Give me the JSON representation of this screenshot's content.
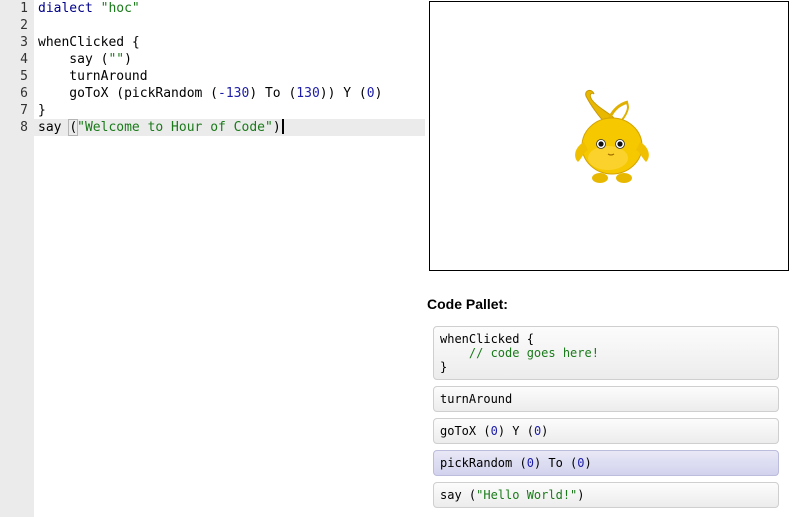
{
  "editor": {
    "lines": [
      {
        "num": "1",
        "parts": [
          {
            "t": "dialect ",
            "c": "kw"
          },
          {
            "t": "\"hoc\"",
            "c": "str"
          }
        ]
      },
      {
        "num": "2",
        "parts": []
      },
      {
        "num": "3",
        "parts": [
          {
            "t": "whenClicked {",
            "c": ""
          }
        ]
      },
      {
        "num": "4",
        "parts": [
          {
            "t": "    say (",
            "c": ""
          },
          {
            "t": "\"\"",
            "c": "str"
          },
          {
            "t": ")",
            "c": ""
          }
        ]
      },
      {
        "num": "5",
        "parts": [
          {
            "t": "    turnAround",
            "c": ""
          }
        ]
      },
      {
        "num": "6",
        "parts": [
          {
            "t": "    goToX (pickRandom (",
            "c": ""
          },
          {
            "t": "-130",
            "c": "num"
          },
          {
            "t": ") To (",
            "c": ""
          },
          {
            "t": "130",
            "c": "num"
          },
          {
            "t": ")) Y (",
            "c": ""
          },
          {
            "t": "0",
            "c": "num"
          },
          {
            "t": ")",
            "c": ""
          }
        ]
      },
      {
        "num": "7",
        "parts": [
          {
            "t": "}",
            "c": ""
          }
        ]
      },
      {
        "num": "8",
        "parts": [
          {
            "t": "say ",
            "c": ""
          },
          {
            "t": "(",
            "c": "paren"
          },
          {
            "t": "\"Welcome to Hour of Code\"",
            "c": "str"
          },
          {
            "t": ")",
            "c": ""
          }
        ],
        "active": true
      }
    ]
  },
  "stage": {
    "sprite": "yellow-creature-sprite"
  },
  "pallet": {
    "title": "Code Pallet:",
    "blocks": [
      {
        "name": "pallet-block-whenclicked",
        "lines": [
          [
            {
              "t": "whenClicked {",
              "c": ""
            }
          ],
          [
            {
              "t": "    // code goes here!",
              "c": "cmt"
            }
          ],
          [
            {
              "t": "}",
              "c": ""
            }
          ]
        ]
      },
      {
        "name": "pallet-block-turnaround",
        "lines": [
          [
            {
              "t": "turnAround",
              "c": ""
            }
          ]
        ]
      },
      {
        "name": "pallet-block-gotox",
        "lines": [
          [
            {
              "t": "goToX (",
              "c": ""
            },
            {
              "t": "0",
              "c": "bnum"
            },
            {
              "t": ") Y (",
              "c": ""
            },
            {
              "t": "0",
              "c": "bnum"
            },
            {
              "t": ")",
              "c": ""
            }
          ]
        ]
      },
      {
        "name": "pallet-block-pickrandom",
        "selected": true,
        "lines": [
          [
            {
              "t": "pickRandom (",
              "c": ""
            },
            {
              "t": "0",
              "c": "bnum"
            },
            {
              "t": ") To (",
              "c": ""
            },
            {
              "t": "0",
              "c": "bnum"
            },
            {
              "t": ")",
              "c": ""
            }
          ]
        ]
      },
      {
        "name": "pallet-block-say",
        "lines": [
          [
            {
              "t": "say (",
              "c": ""
            },
            {
              "t": "\"Hello World!\"",
              "c": "cmt"
            },
            {
              "t": ")",
              "c": ""
            }
          ]
        ]
      }
    ]
  }
}
